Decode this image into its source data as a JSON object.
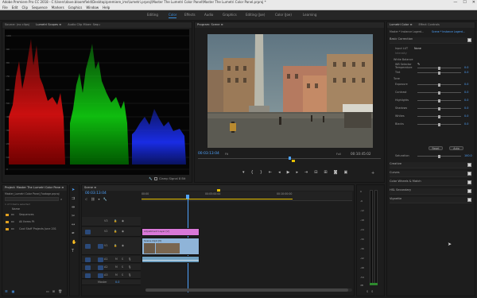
{
  "titlebar": {
    "title": "Adobe Premiere Pro CC 2018 - C:\\Users\\dave.bloomfield\\Desktop\\premiere_ims\\lumetri.prproj\\Master The Lumetri Color Panel\\Master The Lumetri Color Panel.prproj *",
    "minimize": "—",
    "maximize": "☐",
    "close": "✕"
  },
  "menu": [
    "File",
    "Edit",
    "Clip",
    "Sequence",
    "Markers",
    "Graphics",
    "Window",
    "Help"
  ],
  "workspaces": [
    {
      "label": "Editing",
      "active": false
    },
    {
      "label": "Color",
      "active": true
    },
    {
      "label": "Effects",
      "active": false
    },
    {
      "label": "Audio",
      "active": false
    },
    {
      "label": "Graphics",
      "active": false
    },
    {
      "label": "Editing (Joe)",
      "active": false
    },
    {
      "label": "Color (Joe)",
      "active": false
    },
    {
      "label": "Learning",
      "active": false
    }
  ],
  "scopes": {
    "tabs": [
      "Source: (no clips)",
      "Lumetri Scopes ≡",
      "Audio Clip Mixer: Sequ"
    ],
    "scale_labels": [
      "100",
      "90",
      "80",
      "70",
      "60",
      "50",
      "40",
      "30",
      "20",
      "10",
      "0"
    ],
    "clamp_label": "Clamp Signal",
    "bit_depth": "8 Bit",
    "colors": {
      "red": "#e01010",
      "green": "#10d010",
      "blue": "#1a2ef0"
    }
  },
  "program": {
    "tab": "Program: Scene ≡",
    "timecode": "00:03:13:04",
    "fit": "Fit",
    "quality": "Full",
    "duration": "00:10:45:02"
  },
  "lumetri": {
    "tabs": [
      "Lumetri Color ≡",
      "Effect Controls"
    ],
    "source_label": "Master * Instance Lagerd...",
    "target_label": "Scene * Instance Lagerd...",
    "basic_title": "Basic Correction",
    "input_lut_label": "Input LUT",
    "input_lut_value": "None",
    "intensity_label": "Intensity",
    "wb_title": "White Balance",
    "wb_selector": "WB Selector",
    "tone_title": "Tone",
    "sliders": [
      {
        "label": "Temperature",
        "value": "0.0",
        "pos": 0.5
      },
      {
        "label": "Tint",
        "value": "0.0",
        "pos": 0.5
      },
      {
        "label": "Exposure",
        "value": "0.0",
        "pos": 0.5
      },
      {
        "label": "Contrast",
        "value": "0.0",
        "pos": 0.5
      },
      {
        "label": "Highlights",
        "value": "0.0",
        "pos": 0.5
      },
      {
        "label": "Shadows",
        "value": "0.0",
        "pos": 0.5
      },
      {
        "label": "Whites",
        "value": "0.0",
        "pos": 0.5
      },
      {
        "label": "Blacks",
        "value": "0.0",
        "pos": 0.5
      }
    ],
    "reset_label": "Reset",
    "auto_label": "Auto",
    "saturation_label": "Saturation",
    "saturation_value": "100.0",
    "sections": [
      "Creative",
      "Curves",
      "Color Wheels & Match",
      "HSL Secondary",
      "Vignette"
    ]
  },
  "project": {
    "tab": "Project: Master The Lumetri Color Pane ≡",
    "path": "Master_Lumetri Color Panel_Footage.prproj",
    "items_label": "1 of 3 items selected",
    "column": "Name",
    "items": [
      "Sequences",
      "All Items Pt",
      "Cool Stuff Projects June 201"
    ]
  },
  "timeline": {
    "tab": "Scene ≡",
    "timecode": "00:03:13:04",
    "ruler": [
      "00:00",
      "00:05:00:00",
      "00:10:00:00"
    ],
    "tracks_video": [
      "V3",
      "V2",
      "V1"
    ],
    "tracks_audio": [
      "A1",
      "A2",
      "A3"
    ],
    "master_label": "Master",
    "master_value": "0.0",
    "adjustment_clip": "Adjustment Layer [V]",
    "video_clip": "Scene.mp4 [V]",
    "colors": {
      "adjustment": "#d978d8",
      "video": "#8fb4d8",
      "audio": "#6fa0c0"
    }
  },
  "meters": {
    "scale": [
      "0",
      "-6",
      "-12",
      "-18",
      "-24",
      "-30",
      "-36",
      "-42",
      "-48",
      "-54"
    ],
    "db_label": "dB"
  }
}
